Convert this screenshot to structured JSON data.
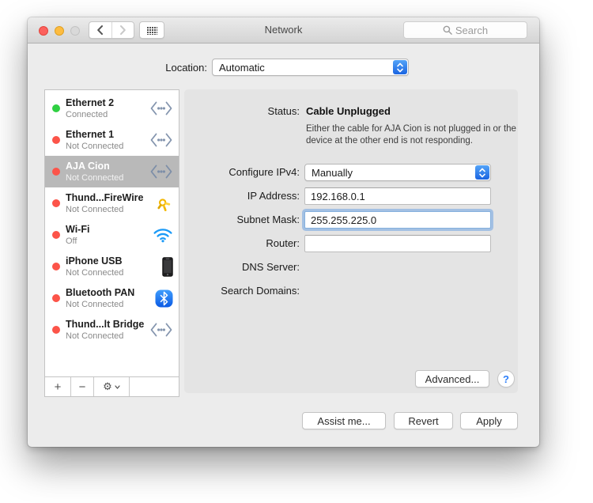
{
  "window": {
    "title": "Network"
  },
  "titlebar": {
    "search_placeholder": "Search"
  },
  "location": {
    "label": "Location:",
    "value": "Automatic"
  },
  "sidebar": {
    "items": [
      {
        "name": "Ethernet 2",
        "status": "Connected",
        "dot": "green",
        "icon": "ethernet",
        "selected": false
      },
      {
        "name": "Ethernet 1",
        "status": "Not Connected",
        "dot": "red",
        "icon": "ethernet",
        "selected": false
      },
      {
        "name": "AJA Cion",
        "status": "Not Connected",
        "dot": "red",
        "icon": "ethernet",
        "selected": true
      },
      {
        "name": "Thund...FireWire",
        "status": "Not Connected",
        "dot": "red",
        "icon": "firewire",
        "selected": false
      },
      {
        "name": "Wi-Fi",
        "status": "Off",
        "dot": "red",
        "icon": "wifi",
        "selected": false
      },
      {
        "name": "iPhone USB",
        "status": "Not Connected",
        "dot": "red",
        "icon": "iphone",
        "selected": false
      },
      {
        "name": "Bluetooth PAN",
        "status": "Not Connected",
        "dot": "red",
        "icon": "bluetooth",
        "selected": false
      },
      {
        "name": "Thund...lt Bridge",
        "status": "Not Connected",
        "dot": "red",
        "icon": "ethernet",
        "selected": false
      }
    ],
    "toolbar": {
      "add_label": "+",
      "remove_label": "−",
      "gear_glyph": "⚙"
    }
  },
  "pane": {
    "status_label": "Status:",
    "status_value": "Cable Unplugged",
    "status_desc": "Either the cable for AJA Cion is not plugged in or the device at the other end is not responding.",
    "configure_label": "Configure IPv4:",
    "configure_value": "Manually",
    "ip_label": "IP Address:",
    "ip_value": "192.168.0.1",
    "subnet_label": "Subnet Mask:",
    "subnet_value": "255.255.225.0",
    "router_label": "Router:",
    "router_value": "",
    "dns_label": "DNS Server:",
    "search_domains_label": "Search Domains:",
    "advanced_button": "Advanced...",
    "help_button": "?"
  },
  "footer": {
    "assist_button": "Assist me...",
    "revert_button": "Revert",
    "apply_button": "Apply"
  },
  "colors": {
    "status_connected": "#2fd042",
    "status_disconnected": "#fc5449",
    "selection_gray": "#b9b9b9",
    "popup_stepper_blue": "#1a64e1",
    "wifi_blue": "#1b9af7",
    "bluetooth_blue": "#0b5ae4",
    "firewire_yellow": "#f3b806",
    "focus_ring_blue": "#78a8e2"
  }
}
